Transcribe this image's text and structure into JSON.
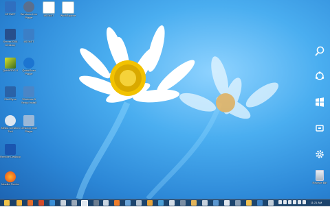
{
  "desktop": {
    "icons": [
      {
        "label": "IIS7NET"
      },
      {
        "label": "Windows Live Player"
      },
      {
        "label": "IIS7NET"
      },
      {
        "label": "Win8Explore"
      },
      {
        "label": "Server2008 Desktop"
      },
      {
        "label": "IIS7NET"
      },
      {
        "label": "QuickRDP 8"
      },
      {
        "label": "QuickScan Player"
      },
      {
        "label": "ShellSync"
      },
      {
        "label": "Windows 8 Setup Install"
      },
      {
        "label": "Media Creation Tool"
      },
      {
        "label": "Desktop Wall Player"
      },
      {
        "label": "Remote Desktop"
      },
      {
        "label": "Mozilla Firefox"
      }
    ],
    "recycle_bin": {
      "label": "Recycle Bin"
    }
  },
  "charms": [
    "search-icon",
    "share-icon",
    "start-icon",
    "devices-icon",
    "settings-icon"
  ],
  "taskbar": {
    "clock": "11:21 AM",
    "pinned": [
      "file-explorer-icon",
      "folder-icon",
      "app-icon",
      "app-icon",
      "app-icon",
      "app-icon",
      "app-icon",
      "app-icon",
      "app-icon",
      "app-icon",
      "app-icon",
      "app-icon",
      "app-icon",
      "app-icon",
      "app-icon",
      "app-icon",
      "app-icon",
      "app-icon",
      "app-icon",
      "app-icon",
      "app-icon",
      "app-icon",
      "app-icon",
      "app-icon",
      "app-icon"
    ]
  }
}
